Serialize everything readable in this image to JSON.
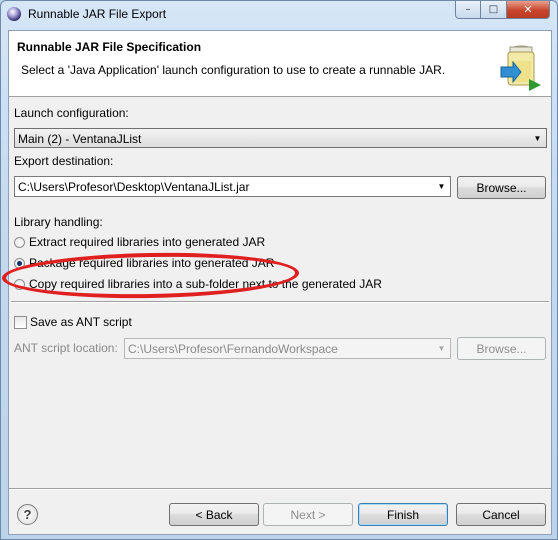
{
  "window": {
    "title": "Runnable JAR File Export",
    "minimize_glyph": "–",
    "maximize_glyph": "□",
    "close_glyph": "✕"
  },
  "header": {
    "title": "Runnable JAR File Specification",
    "description": "Select a 'Java Application' launch configuration to use to create a runnable JAR."
  },
  "launch": {
    "label": "Launch configuration:",
    "value": "Main (2) - VentanaJList"
  },
  "export": {
    "label": "Export destination:",
    "value": "C:\\Users\\Profesor\\Desktop\\VentanaJList.jar",
    "browse_label": "Browse..."
  },
  "library": {
    "label": "Library handling:",
    "options": [
      {
        "label": "Extract required libraries into generated JAR",
        "checked": false
      },
      {
        "label": "Package required libraries into generated JAR",
        "checked": true
      },
      {
        "label": "Copy required libraries into a sub-folder next to the generated JAR",
        "checked": false
      }
    ]
  },
  "ant": {
    "checkbox_label": "Save as ANT script",
    "checked": false,
    "location_label": "ANT script location:",
    "location_value": "C:\\Users\\Profesor\\FernandoWorkspace",
    "browse_label": "Browse..."
  },
  "footer": {
    "help_glyph": "?",
    "back_label": "< Back",
    "next_label": "Next >",
    "finish_label": "Finish",
    "cancel_label": "Cancel"
  },
  "annotation": {
    "color": "#e02020",
    "highlights": "Package required libraries into generated JAR"
  },
  "colors": {
    "title_bar": "#c5d9ef",
    "dialog_bg": "#f0f0f0",
    "header_bg": "#ffffff",
    "close_button": "#c9452a"
  }
}
